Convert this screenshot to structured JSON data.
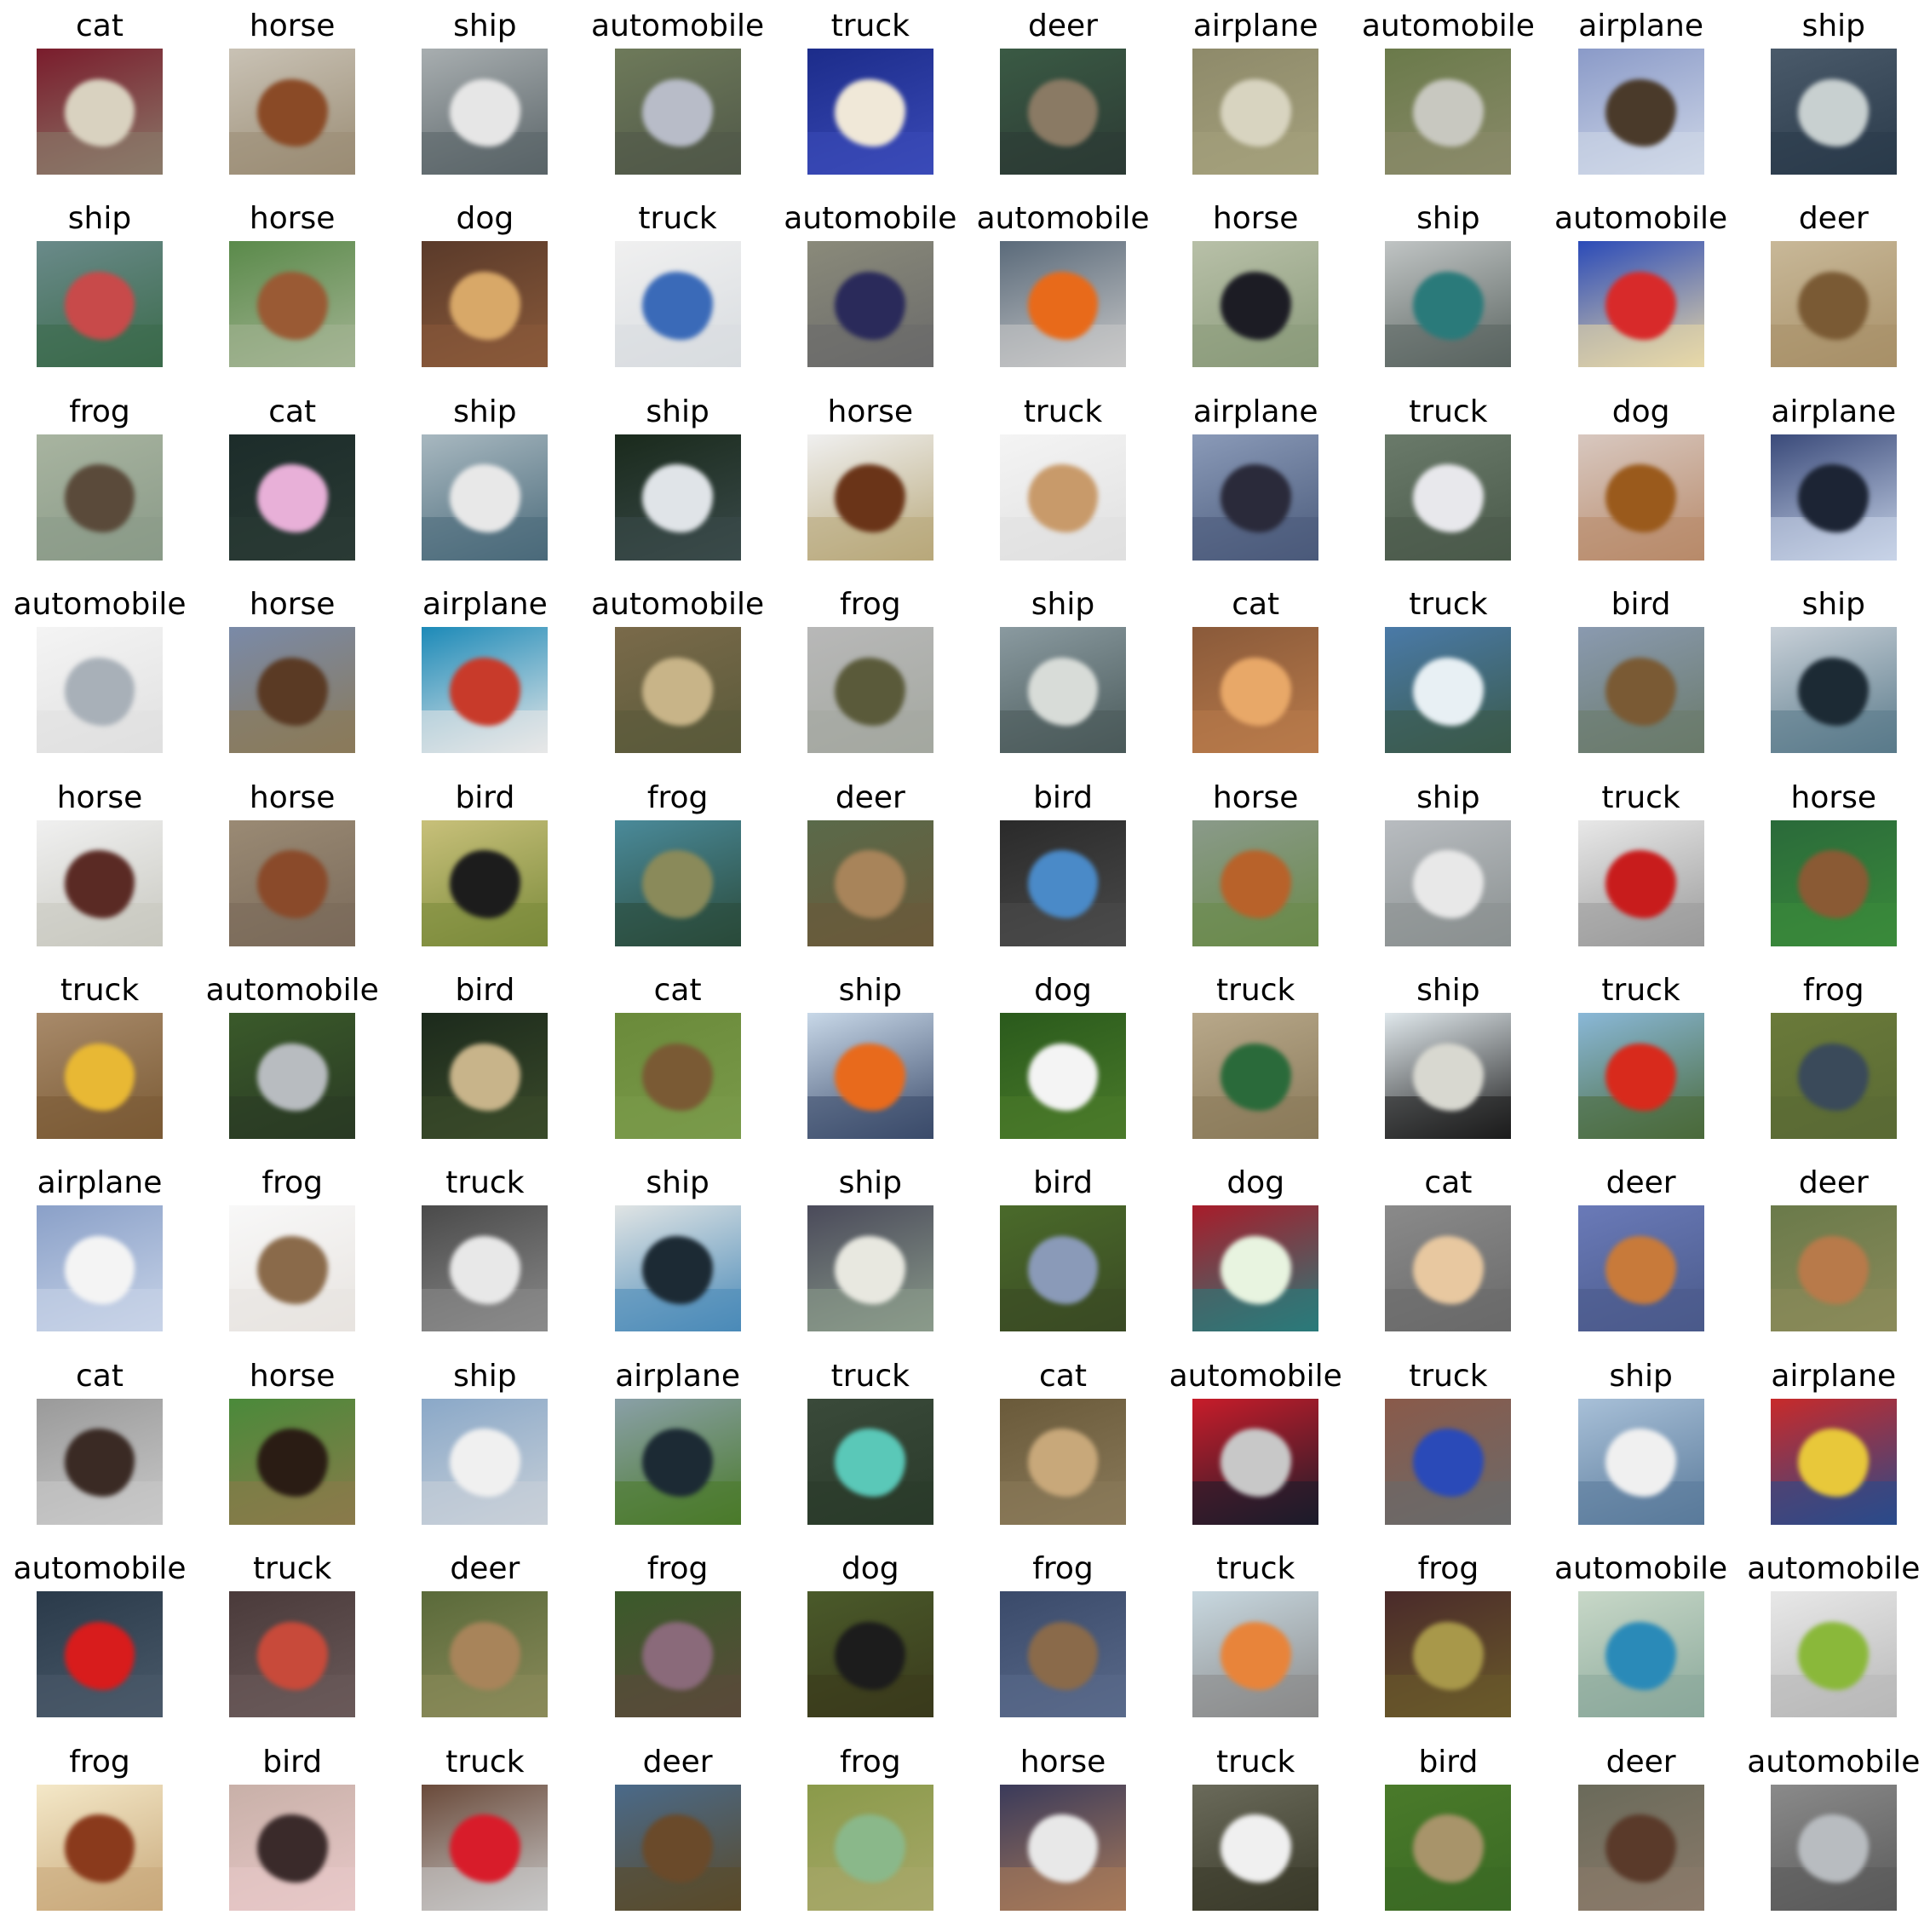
{
  "images": [
    {
      "label": "cat",
      "icon": "cat-icon",
      "colors": {
        "bg": "#7a1c2c",
        "mid": "#8a7a6a",
        "subject": "#d9d2c0"
      }
    },
    {
      "label": "horse",
      "icon": "horse-icon",
      "colors": {
        "bg": "#c9c2b5",
        "mid": "#9a8c74",
        "subject": "#8a4a26"
      }
    },
    {
      "label": "ship",
      "icon": "ship-icon",
      "colors": {
        "bg": "#a8aeb0",
        "mid": "#5a6468",
        "subject": "#e6e6e6"
      }
    },
    {
      "label": "automobile",
      "icon": "automobile-icon",
      "colors": {
        "bg": "#6e7a5a",
        "mid": "#505848",
        "subject": "#b8bcc8"
      }
    },
    {
      "label": "truck",
      "icon": "truck-icon",
      "colors": {
        "bg": "#1c2c8a",
        "mid": "#3a4ab8",
        "subject": "#f0e8d8"
      }
    },
    {
      "label": "deer",
      "icon": "deer-icon",
      "colors": {
        "bg": "#3a5a44",
        "mid": "#2c3a34",
        "subject": "#8a7a64"
      }
    },
    {
      "label": "airplane",
      "icon": "airplane-icon",
      "colors": {
        "bg": "#8e8a6a",
        "mid": "#a4a07c",
        "subject": "#d8d4c0"
      }
    },
    {
      "label": "automobile",
      "icon": "automobile-icon",
      "colors": {
        "bg": "#6a7a4a",
        "mid": "#8a8a6a",
        "subject": "#c8c8c0"
      }
    },
    {
      "label": "airplane",
      "icon": "airplane-icon",
      "colors": {
        "bg": "#8a9ac8",
        "mid": "#d0d8e8",
        "subject": "#4a3a2a"
      }
    },
    {
      "label": "ship",
      "icon": "ship-icon",
      "colors": {
        "bg": "#4a5a6a",
        "mid": "#2a3a4a",
        "subject": "#c8d0d0"
      }
    },
    {
      "label": "ship",
      "icon": "ship-icon",
      "colors": {
        "bg": "#6a8a8a",
        "mid": "#3a6a4a",
        "subject": "#c84a4a"
      }
    },
    {
      "label": "horse",
      "icon": "horse-icon",
      "colors": {
        "bg": "#5a8a4a",
        "mid": "#a4b494",
        "subject": "#9a5a34"
      }
    },
    {
      "label": "dog",
      "icon": "dog-icon",
      "colors": {
        "bg": "#5a3a2a",
        "mid": "#8a5a3a",
        "subject": "#d8a868"
      }
    },
    {
      "label": "truck",
      "icon": "truck-icon",
      "colors": {
        "bg": "#f0f0f0",
        "mid": "#d8dce0",
        "subject": "#3a6ab8"
      }
    },
    {
      "label": "automobile",
      "icon": "automobile-icon",
      "colors": {
        "bg": "#8a8a7a",
        "mid": "#6a6a6a",
        "subject": "#2a2a5a"
      }
    },
    {
      "label": "automobile",
      "icon": "automobile-icon",
      "colors": {
        "bg": "#5a6a7a",
        "mid": "#c8c8c8",
        "subject": "#e86a1a"
      }
    },
    {
      "label": "horse",
      "icon": "horse-icon",
      "colors": {
        "bg": "#b8c0a8",
        "mid": "#8a9a7a",
        "subject": "#1c1c24"
      }
    },
    {
      "label": "ship",
      "icon": "ship-icon",
      "colors": {
        "bg": "#c0c4c4",
        "mid": "#5a6460",
        "subject": "#2a7a7a"
      }
    },
    {
      "label": "automobile",
      "icon": "automobile-icon",
      "colors": {
        "bg": "#2a4ab8",
        "mid": "#e8d8a8",
        "subject": "#d82a2a"
      }
    },
    {
      "label": "deer",
      "icon": "deer-icon",
      "colors": {
        "bg": "#c8b898",
        "mid": "#a89068",
        "subject": "#7a5a34"
      }
    },
    {
      "label": "frog",
      "icon": "frog-icon",
      "colors": {
        "bg": "#a8b4a0",
        "mid": "#8a9a88",
        "subject": "#5a4a3a"
      }
    },
    {
      "label": "cat",
      "icon": "cat-icon",
      "colors": {
        "bg": "#1c2c2a",
        "mid": "#2a3a34",
        "subject": "#e8b0d8"
      }
    },
    {
      "label": "ship",
      "icon": "ship-icon",
      "colors": {
        "bg": "#a8b8c0",
        "mid": "#4a6a7a",
        "subject": "#e8e8e8"
      }
    },
    {
      "label": "ship",
      "icon": "ship-icon",
      "colors": {
        "bg": "#1a2a1c",
        "mid": "#3a4a4a",
        "subject": "#e0e4e8"
      }
    },
    {
      "label": "horse",
      "icon": "horse-icon",
      "colors": {
        "bg": "#f0f0f0",
        "mid": "#b8a87a",
        "subject": "#6a3418"
      }
    },
    {
      "label": "truck",
      "icon": "truck-icon",
      "colors": {
        "bg": "#f4f4f4",
        "mid": "#e0e0e0",
        "subject": "#c89a6a"
      }
    },
    {
      "label": "airplane",
      "icon": "airplane-icon",
      "colors": {
        "bg": "#8a9ab8",
        "mid": "#4a5a7a",
        "subject": "#2a2a3a"
      }
    },
    {
      "label": "truck",
      "icon": "truck-icon",
      "colors": {
        "bg": "#6a7a6a",
        "mid": "#4a5a4a",
        "subject": "#e8e8ec"
      }
    },
    {
      "label": "dog",
      "icon": "dog-icon",
      "colors": {
        "bg": "#d8c8c0",
        "mid": "#b88a6a",
        "subject": "#9a5a1c"
      }
    },
    {
      "label": "airplane",
      "icon": "airplane-icon",
      "colors": {
        "bg": "#3a4a7a",
        "mid": "#c8d4e8",
        "subject": "#1c2434"
      }
    },
    {
      "label": "automobile",
      "icon": "automobile-icon",
      "colors": {
        "bg": "#f4f4f4",
        "mid": "#e0e0e0",
        "subject": "#a8b0b8"
      }
    },
    {
      "label": "horse",
      "icon": "horse-icon",
      "colors": {
        "bg": "#7a8aa8",
        "mid": "#8a7a5a",
        "subject": "#5a3a24"
      }
    },
    {
      "label": "airplane",
      "icon": "airplane-icon",
      "colors": {
        "bg": "#1c8ab8",
        "mid": "#e8e8e8",
        "subject": "#c83a2a"
      }
    },
    {
      "label": "automobile",
      "icon": "automobile-icon",
      "colors": {
        "bg": "#7a6a4a",
        "mid": "#5a5a3a",
        "subject": "#c8b488"
      }
    },
    {
      "label": "frog",
      "icon": "frog-icon",
      "colors": {
        "bg": "#b8b8b8",
        "mid": "#a4a8a0",
        "subject": "#5a5a3a"
      }
    },
    {
      "label": "ship",
      "icon": "ship-icon",
      "colors": {
        "bg": "#8a9aa0",
        "mid": "#4a5a5a",
        "subject": "#d8dcd8"
      }
    },
    {
      "label": "cat",
      "icon": "cat-icon",
      "colors": {
        "bg": "#8a5a3a",
        "mid": "#b87a4a",
        "subject": "#e8a868"
      }
    },
    {
      "label": "truck",
      "icon": "truck-icon",
      "colors": {
        "bg": "#4a7aa8",
        "mid": "#3a5a4a",
        "subject": "#e8f0f4"
      }
    },
    {
      "label": "bird",
      "icon": "bird-icon",
      "colors": {
        "bg": "#8a9ab0",
        "mid": "#6a7a6a",
        "subject": "#7a5a34"
      }
    },
    {
      "label": "ship",
      "icon": "ship-icon",
      "colors": {
        "bg": "#c8d0d8",
        "mid": "#5a7a8a",
        "subject": "#1c2a34"
      }
    },
    {
      "label": "horse",
      "icon": "horse-icon",
      "colors": {
        "bg": "#f0f0f0",
        "mid": "#c8c8c0",
        "subject": "#5a2a24"
      }
    },
    {
      "label": "horse",
      "icon": "horse-icon",
      "colors": {
        "bg": "#9a8a74",
        "mid": "#7a6a5a",
        "subject": "#8a4a2a"
      }
    },
    {
      "label": "bird",
      "icon": "bird-icon",
      "colors": {
        "bg": "#c8c07a",
        "mid": "#7a8a3a",
        "subject": "#1c1c1c"
      }
    },
    {
      "label": "frog",
      "icon": "frog-icon",
      "colors": {
        "bg": "#4a8a9a",
        "mid": "#2a4a3a",
        "subject": "#8a8a5a"
      }
    },
    {
      "label": "deer",
      "icon": "deer-icon",
      "colors": {
        "bg": "#5a6a4a",
        "mid": "#6a5a3a",
        "subject": "#a8845a"
      }
    },
    {
      "label": "bird",
      "icon": "bird-icon",
      "colors": {
        "bg": "#2a2a2a",
        "mid": "#4a4a4a",
        "subject": "#4a8ac8"
      }
    },
    {
      "label": "horse",
      "icon": "horse-icon",
      "colors": {
        "bg": "#8a9a8a",
        "mid": "#6a8a4a",
        "subject": "#b8622a"
      }
    },
    {
      "label": "ship",
      "icon": "ship-icon",
      "colors": {
        "bg": "#b8bcc0",
        "mid": "#8a9090",
        "subject": "#e8e8e8"
      }
    },
    {
      "label": "truck",
      "icon": "truck-icon",
      "colors": {
        "bg": "#e8e8e8",
        "mid": "#9a9a9a",
        "subject": "#c81c1c"
      }
    },
    {
      "label": "horse",
      "icon": "horse-icon",
      "colors": {
        "bg": "#2a6a3a",
        "mid": "#3a8a3a",
        "subject": "#8a5a34"
      }
    },
    {
      "label": "truck",
      "icon": "truck-icon",
      "colors": {
        "bg": "#a88a6a",
        "mid": "#7a5a34",
        "subject": "#e8b834"
      }
    },
    {
      "label": "automobile",
      "icon": "automobile-icon",
      "colors": {
        "bg": "#3a5a2a",
        "mid": "#2a3a24",
        "subject": "#b8bcc0"
      }
    },
    {
      "label": "bird",
      "icon": "bird-icon",
      "colors": {
        "bg": "#1c2a1c",
        "mid": "#3a4a2a",
        "subject": "#c8b48a"
      }
    },
    {
      "label": "cat",
      "icon": "cat-icon",
      "colors": {
        "bg": "#6a8a3a",
        "mid": "#7a9a4a",
        "subject": "#7a5a34"
      }
    },
    {
      "label": "ship",
      "icon": "ship-icon",
      "colors": {
        "bg": "#c8d8e8",
        "mid": "#3a4a6a",
        "subject": "#e86a1c"
      }
    },
    {
      "label": "dog",
      "icon": "dog-icon",
      "colors": {
        "bg": "#2a5a1c",
        "mid": "#4a7a2a",
        "subject": "#f4f4f4"
      }
    },
    {
      "label": "truck",
      "icon": "truck-icon",
      "colors": {
        "bg": "#b8a88a",
        "mid": "#8a7a5a",
        "subject": "#2a6a3a"
      }
    },
    {
      "label": "ship",
      "icon": "ship-icon",
      "colors": {
        "bg": "#e0e8ec",
        "mid": "#1c1c1c",
        "subject": "#d8d8d0"
      }
    },
    {
      "label": "truck",
      "icon": "truck-icon",
      "colors": {
        "bg": "#8ab8d8",
        "mid": "#4a6a3a",
        "subject": "#d82a1c"
      }
    },
    {
      "label": "frog",
      "icon": "frog-icon",
      "colors": {
        "bg": "#6a7a3a",
        "mid": "#5a6a34",
        "subject": "#3a4a5a"
      }
    },
    {
      "label": "airplane",
      "icon": "airplane-icon",
      "colors": {
        "bg": "#8aa0c8",
        "mid": "#c8d4e8",
        "subject": "#f4f4f4"
      }
    },
    {
      "label": "frog",
      "icon": "frog-icon",
      "colors": {
        "bg": "#f8f8f8",
        "mid": "#e8e4e0",
        "subject": "#8a6a4a"
      }
    },
    {
      "label": "truck",
      "icon": "truck-icon",
      "colors": {
        "bg": "#4a4a4a",
        "mid": "#8a8a8a",
        "subject": "#e8e8e8"
      }
    },
    {
      "label": "ship",
      "icon": "ship-icon",
      "colors": {
        "bg": "#e0e4e4",
        "mid": "#4a8ab8",
        "subject": "#1c2a34"
      }
    },
    {
      "label": "ship",
      "icon": "ship-icon",
      "colors": {
        "bg": "#4a4a5a",
        "mid": "#8a9a8a",
        "subject": "#e8e8e0"
      }
    },
    {
      "label": "bird",
      "icon": "bird-icon",
      "colors": {
        "bg": "#4a6a2a",
        "mid": "#3a4a24",
        "subject": "#8a9ab8"
      }
    },
    {
      "label": "dog",
      "icon": "dog-icon",
      "colors": {
        "bg": "#a81c2a",
        "mid": "#2a7a7a",
        "subject": "#e8f4e0"
      }
    },
    {
      "label": "cat",
      "icon": "cat-icon",
      "colors": {
        "bg": "#8a8a8a",
        "mid": "#6a6a6a",
        "subject": "#e8c8a0"
      }
    },
    {
      "label": "deer",
      "icon": "deer-icon",
      "colors": {
        "bg": "#6a7ab8",
        "mid": "#4a5a8a",
        "subject": "#c87a3a"
      }
    },
    {
      "label": "deer",
      "icon": "deer-icon",
      "colors": {
        "bg": "#6a7a4a",
        "mid": "#8a8a5a",
        "subject": "#b87a4a"
      }
    },
    {
      "label": "cat",
      "icon": "cat-icon",
      "colors": {
        "bg": "#9a9a9a",
        "mid": "#c8c8c8",
        "subject": "#3a2a24"
      }
    },
    {
      "label": "horse",
      "icon": "horse-icon",
      "colors": {
        "bg": "#4a8a3a",
        "mid": "#8a7a4a",
        "subject": "#2a1c14"
      }
    },
    {
      "label": "ship",
      "icon": "ship-icon",
      "colors": {
        "bg": "#8aa8c8",
        "mid": "#c8d0d8",
        "subject": "#f0f0f0"
      }
    },
    {
      "label": "airplane",
      "icon": "airplane-icon",
      "colors": {
        "bg": "#8aa0a8",
        "mid": "#4a7a2a",
        "subject": "#1c2a34"
      }
    },
    {
      "label": "truck",
      "icon": "truck-icon",
      "colors": {
        "bg": "#3a4a3a",
        "mid": "#2a3a2a",
        "subject": "#5ac8b8"
      }
    },
    {
      "label": "cat",
      "icon": "cat-icon",
      "colors": {
        "bg": "#6a5a3a",
        "mid": "#8a7a5a",
        "subject": "#c8a87a"
      }
    },
    {
      "label": "automobile",
      "icon": "automobile-icon",
      "colors": {
        "bg": "#c81c2a",
        "mid": "#1c1c2a",
        "subject": "#c8c8c8"
      }
    },
    {
      "label": "truck",
      "icon": "truck-icon",
      "colors": {
        "bg": "#8a5a4a",
        "mid": "#6a6a6a",
        "subject": "#2a4ab8"
      }
    },
    {
      "label": "ship",
      "icon": "ship-icon",
      "colors": {
        "bg": "#a8c0d8",
        "mid": "#5a7a9a",
        "subject": "#f0f0f0"
      }
    },
    {
      "label": "airplane",
      "icon": "airplane-icon",
      "colors": {
        "bg": "#c82a2a",
        "mid": "#2a4a8a",
        "subject": "#e8c83a"
      }
    },
    {
      "label": "automobile",
      "icon": "automobile-icon",
      "colors": {
        "bg": "#2a3a4a",
        "mid": "#4a5a6a",
        "subject": "#d81c1c"
      }
    },
    {
      "label": "truck",
      "icon": "truck-icon",
      "colors": {
        "bg": "#4a3a3a",
        "mid": "#6a5a5a",
        "subject": "#c84a3a"
      }
    },
    {
      "label": "deer",
      "icon": "deer-icon",
      "colors": {
        "bg": "#5a6a3a",
        "mid": "#8a8a5a",
        "subject": "#a8845a"
      }
    },
    {
      "label": "frog",
      "icon": "frog-icon",
      "colors": {
        "bg": "#3a5a2a",
        "mid": "#5a4a3a",
        "subject": "#8a6a7a"
      }
    },
    {
      "label": "dog",
      "icon": "dog-icon",
      "colors": {
        "bg": "#4a5a2a",
        "mid": "#3a3a1c",
        "subject": "#1c1c1c"
      }
    },
    {
      "label": "frog",
      "icon": "frog-icon",
      "colors": {
        "bg": "#3a4a6a",
        "mid": "#5a6a8a",
        "subject": "#8a6a4a"
      }
    },
    {
      "label": "truck",
      "icon": "truck-icon",
      "colors": {
        "bg": "#c8d8e0",
        "mid": "#8a8a8a",
        "subject": "#e8843a"
      }
    },
    {
      "label": "frog",
      "icon": "frog-icon",
      "colors": {
        "bg": "#4a2a2a",
        "mid": "#6a5a2a",
        "subject": "#a8984a"
      }
    },
    {
      "label": "automobile",
      "icon": "automobile-icon",
      "colors": {
        "bg": "#c8d8c8",
        "mid": "#8aa89a",
        "subject": "#2a8ab8"
      }
    },
    {
      "label": "automobile",
      "icon": "automobile-icon",
      "colors": {
        "bg": "#e8e8e8",
        "mid": "#b8b8b8",
        "subject": "#8ab83a"
      }
    },
    {
      "label": "frog",
      "icon": "frog-icon",
      "colors": {
        "bg": "#f4e8c8",
        "mid": "#c8a87a",
        "subject": "#8a3a1c"
      }
    },
    {
      "label": "bird",
      "icon": "bird-icon",
      "colors": {
        "bg": "#c8b0a8",
        "mid": "#e8c8c8",
        "subject": "#3a2a2a"
      }
    },
    {
      "label": "truck",
      "icon": "truck-icon",
      "colors": {
        "bg": "#6a4a3a",
        "mid": "#c8c8c8",
        "subject": "#d81c2a"
      }
    },
    {
      "label": "deer",
      "icon": "deer-icon",
      "colors": {
        "bg": "#4a6a8a",
        "mid": "#5a4a2a",
        "subject": "#6a4a2a"
      }
    },
    {
      "label": "frog",
      "icon": "frog-icon",
      "colors": {
        "bg": "#8a9a4a",
        "mid": "#a8a86a",
        "subject": "#8ab88a"
      }
    },
    {
      "label": "horse",
      "icon": "horse-icon",
      "colors": {
        "bg": "#3a3a5a",
        "mid": "#a87a5a",
        "subject": "#e8e8e8"
      }
    },
    {
      "label": "truck",
      "icon": "truck-icon",
      "colors": {
        "bg": "#6a6a5a",
        "mid": "#3a3a2a",
        "subject": "#f0f0f0"
      }
    },
    {
      "label": "bird",
      "icon": "bird-icon",
      "colors": {
        "bg": "#4a7a2a",
        "mid": "#3a6a24",
        "subject": "#a8946a"
      }
    },
    {
      "label": "deer",
      "icon": "deer-icon",
      "colors": {
        "bg": "#6a6a5a",
        "mid": "#8a7a6a",
        "subject": "#5a3a2a"
      }
    },
    {
      "label": "automobile",
      "icon": "automobile-icon",
      "colors": {
        "bg": "#8a8a8a",
        "mid": "#5a5a5a",
        "subject": "#b8bcc0"
      }
    }
  ]
}
